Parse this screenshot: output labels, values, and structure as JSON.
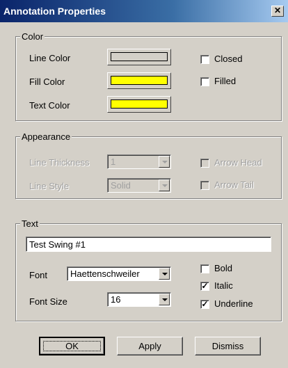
{
  "window": {
    "title": "Annotation Properties",
    "close_glyph": "✕"
  },
  "color_group": {
    "legend": "Color",
    "line_color_label": "Line Color",
    "fill_color_label": "Fill Color",
    "text_color_label": "Text Color",
    "line_color": "#d4d0c8",
    "fill_color": "#ffff00",
    "text_color": "#ffff00",
    "closed_label": "Closed",
    "closed_checked": false,
    "filled_label": "Filled",
    "filled_checked": false
  },
  "appearance_group": {
    "legend": "Appearance",
    "line_thickness_label": "Line Thickness",
    "line_thickness_value": "1",
    "line_style_label": "Line Style",
    "line_style_value": "Solid",
    "arrow_head_label": "Arrow Head",
    "arrow_tail_label": "Arrow Tail",
    "disabled": true
  },
  "text_group": {
    "legend": "Text",
    "text_value": "Test Swing #1",
    "font_label": "Font",
    "font_value": "Haettenschweiler",
    "font_size_label": "Font Size",
    "font_size_value": "16",
    "bold_label": "Bold",
    "bold_checked": false,
    "italic_label": "Italic",
    "italic_checked": true,
    "underline_label": "Underline",
    "underline_checked": true
  },
  "buttons": {
    "ok": "OK",
    "apply": "Apply",
    "dismiss": "Dismiss"
  },
  "check_glyph": "✓"
}
